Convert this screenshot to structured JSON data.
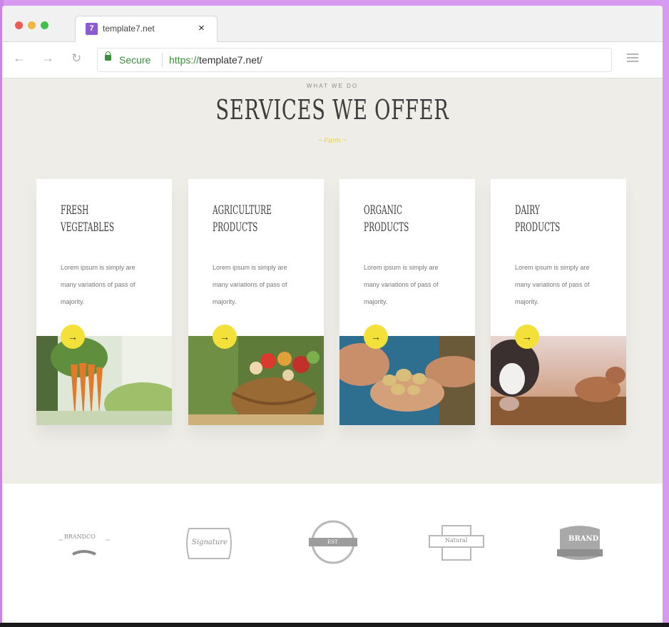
{
  "browser": {
    "tab_title": "template7.net",
    "tab_close": "×",
    "favicon_letter": "7",
    "secure_label": "Secure",
    "url_scheme": "https://",
    "url_rest": "template7.net/",
    "back_icon": "←",
    "forward_icon": "→",
    "reload_icon": "↻"
  },
  "services": {
    "eyebrow": "WHAT WE DO",
    "title": "SERVICES WE OFFER",
    "ornament": "~ Farm ~",
    "cards": [
      {
        "title": "FRESH\nVEGETABLES",
        "desc": "Lorem ipsum is simply are many variations of pass of majority.",
        "arrow": "→",
        "image": "carrots"
      },
      {
        "title": "AGRICULTURE\nPRODUCTS",
        "desc": "Lorem ipsum is simply are many variations of pass of majority.",
        "arrow": "→",
        "image": "vegetable-basket"
      },
      {
        "title": "ORGANIC\nPRODUCTS",
        "desc": "Lorem ipsum is simply are many variations of pass of majority.",
        "arrow": "→",
        "image": "potatoes-in-hands"
      },
      {
        "title": "DAIRY\nPRODUCTS",
        "desc": "Lorem ipsum is simply are many variations of pass of majority.",
        "arrow": "→",
        "image": "cow"
      }
    ]
  },
  "partners": {
    "logos": [
      {
        "name": "badge-logo-1",
        "text": "BRANDCO"
      },
      {
        "name": "badge-logo-2",
        "text": "Signature"
      },
      {
        "name": "badge-logo-3",
        "text": "EST"
      },
      {
        "name": "badge-logo-4",
        "text": "Natural"
      },
      {
        "name": "badge-logo-5",
        "text": "BRAND"
      }
    ]
  },
  "colors": {
    "accent_yellow": "#f3e13a",
    "section_bg": "#efede8",
    "frame_purple": "#d79af0",
    "secure_green": "#3a8f3a"
  }
}
